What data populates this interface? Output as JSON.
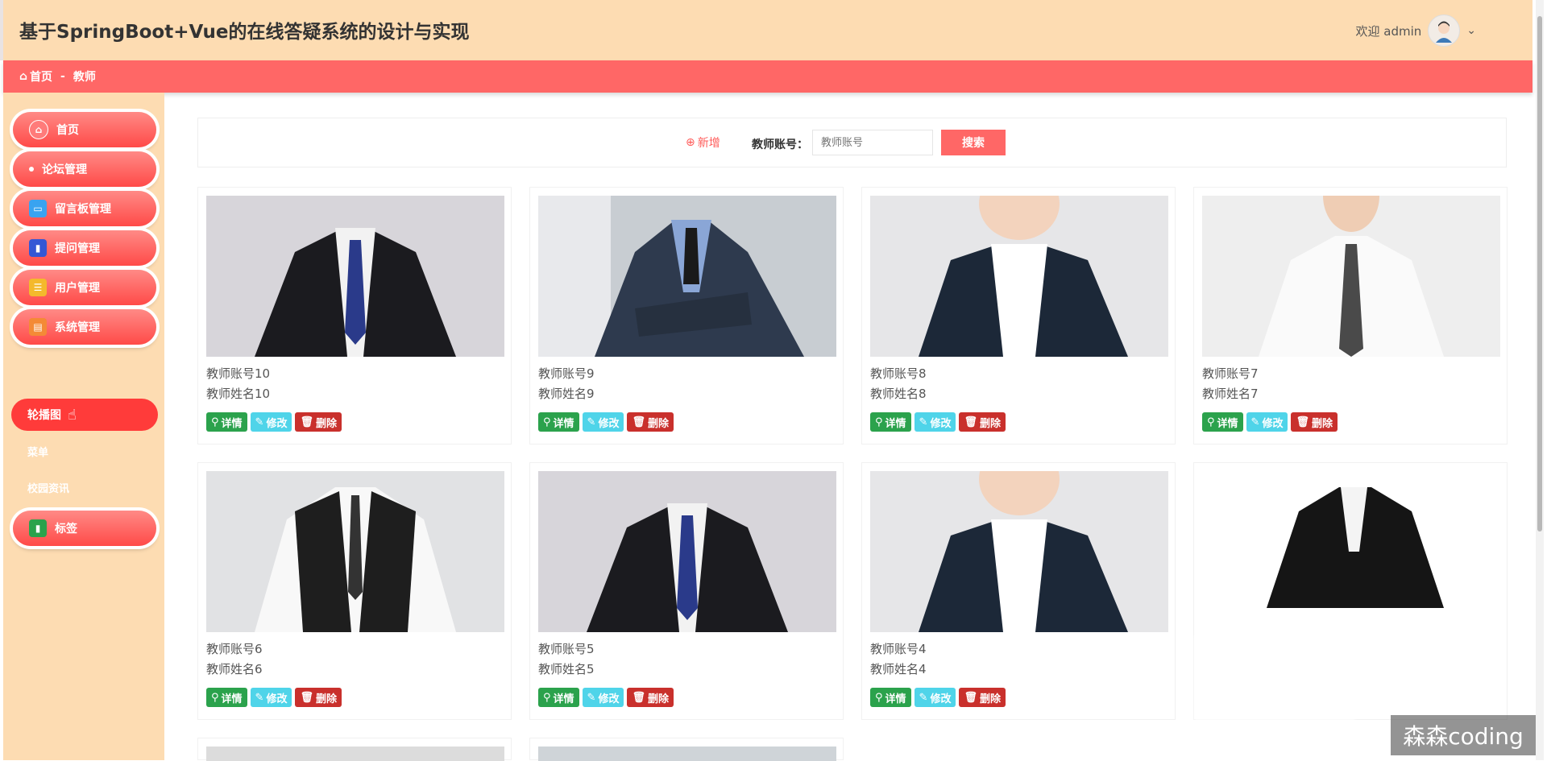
{
  "header": {
    "title": "基于SpringBoot+Vue的在线答疑系统的设计与实现",
    "welcome": "欢迎 admin"
  },
  "breadcrumb": {
    "home": "首页",
    "separator": "-",
    "current": "教师"
  },
  "sidebar": {
    "items": [
      {
        "label": "首页",
        "icon": "home-icon"
      },
      {
        "label": "论坛管理",
        "icon": "dot-icon"
      },
      {
        "label": "留言板管理",
        "icon": "message-icon"
      },
      {
        "label": "提问管理",
        "icon": "book-icon"
      },
      {
        "label": "用户管理",
        "icon": "users-icon"
      },
      {
        "label": "系统管理",
        "icon": "settings-icon"
      }
    ],
    "submenu": {
      "active": "轮播图",
      "items": [
        "菜单",
        "校园资讯"
      ]
    },
    "last": {
      "label": "标签",
      "icon": "tag-icon"
    }
  },
  "search": {
    "add_label": "新增",
    "field_label": "教师账号：",
    "placeholder": "教师账号",
    "button": "搜索"
  },
  "cards": [
    {
      "account": "教师账号10",
      "name": "教师姓名10"
    },
    {
      "account": "教师账号9",
      "name": "教师姓名9"
    },
    {
      "account": "教师账号8",
      "name": "教师姓名8"
    },
    {
      "account": "教师账号7",
      "name": "教师姓名7"
    },
    {
      "account": "教师账号6",
      "name": "教师姓名6"
    },
    {
      "account": "教师账号5",
      "name": "教师姓名5"
    },
    {
      "account": "教师账号4",
      "name": "教师姓名4"
    }
  ],
  "card_buttons": {
    "detail": "详情",
    "edit": "修改",
    "delete": "删除"
  },
  "watermark": "森森coding",
  "colors": {
    "header_bg": "#fddcb2",
    "accent": "#ff6766",
    "detail": "#2ba24c",
    "edit": "#4fd4e9",
    "delete": "#c9302c"
  }
}
